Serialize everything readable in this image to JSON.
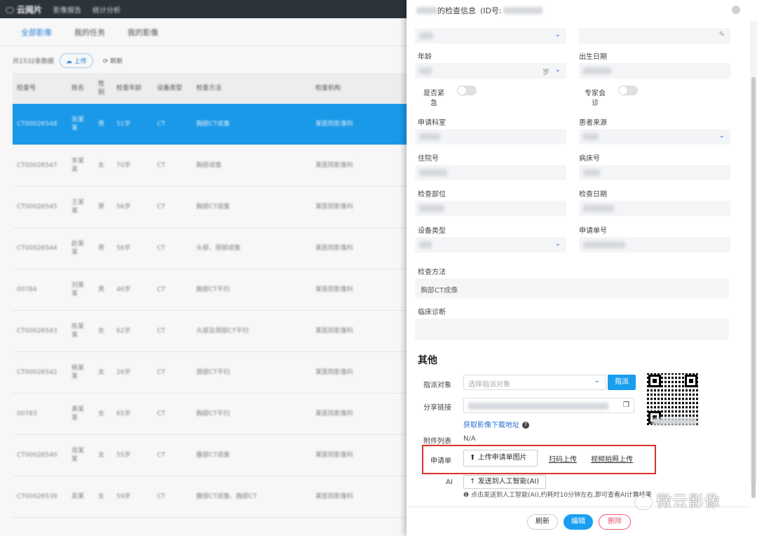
{
  "topbar": {
    "brand": "云阅片",
    "nav": [
      "影像报告",
      "统计分析"
    ]
  },
  "tabs": [
    "全部影像",
    "我的任务",
    "我的影像"
  ],
  "toolbar": {
    "count": "共1532条数据",
    "upload": "上传",
    "refresh": "刷新"
  },
  "table": {
    "columns": [
      "检查号",
      "姓名",
      "性别",
      "检查年龄",
      "设备类型",
      "检查方法",
      "检查机构"
    ],
    "rows": [
      [
        "CT00026548",
        "张某某",
        "男",
        "51岁",
        "CT",
        "胸部CT成像",
        "某医院影像科"
      ],
      [
        "CT00026547",
        "李某某",
        "女",
        "70岁",
        "CT",
        "胸部成像",
        "某医院影像科"
      ],
      [
        "CT00026545",
        "王某某",
        "男",
        "56岁",
        "CT",
        "胸部CT成像",
        "某医院影像科"
      ],
      [
        "CT00026544",
        "赵某某",
        "男",
        "56岁",
        "CT",
        "头部、颈部成像",
        "某医院影像科"
      ],
      [
        "00784",
        "刘某某",
        "男",
        "46岁",
        "CT",
        "胸部CT平扫",
        "某医院影像科"
      ],
      [
        "CT00026543",
        "陈某某",
        "女",
        "62岁",
        "CT",
        "头部及颈部CT平扫",
        "某医院影像科"
      ],
      [
        "CT00026542",
        "杨某某",
        "女",
        "26岁",
        "CT",
        "颈部CT平扫",
        "某医院影像科"
      ],
      [
        "00783",
        "黄某某",
        "女",
        "65岁",
        "CT",
        "胸部CT平扫",
        "某医院影像科"
      ],
      [
        "CT00026540",
        "周某某",
        "女",
        "55岁",
        "CT",
        "腹部CT成像",
        "某医院影像科"
      ],
      [
        "CT00026539",
        "吴某",
        "女",
        "59岁",
        "CT",
        "腹部CT成像、胸部CT",
        "某医院影像科"
      ]
    ]
  },
  "panel": {
    "title": "的检查信息",
    "id_label": "(ID号:",
    "labels": {
      "age": "年龄",
      "birth": "出生日期",
      "urgent": "是否紧急",
      "expert": "专家会诊",
      "dept": "申请科室",
      "source": "患者来源",
      "inpatient": "住院号",
      "bed": "病床号",
      "part": "检查部位",
      "date": "检查日期",
      "device": "设备类型",
      "order": "申请单号",
      "method": "检查方法",
      "diagnosis": "临床诊断"
    },
    "age_unit": "岁",
    "method_value": "胸部CT成像",
    "other": {
      "title": "其他",
      "assign_label": "指派对象",
      "assign_placeholder": "选择指派对象",
      "assign_button": "指派",
      "share_label": "分享链接",
      "download_link": "获取影像下载地址",
      "attach_label": "附件列表",
      "attach_value": "N/A",
      "request_label": "申请单",
      "upload_image": "上传申请单图片",
      "scan_upload": "扫码上传",
      "video_upload": "视频拍照上传",
      "ai_label": "AI",
      "ai_button": "发送到人工智能(AI)",
      "ai_note": "点击发送到人工智能(AI),约耗时10分钟左右,即可查看AI计算结果"
    },
    "footer": {
      "refresh": "刷新",
      "edit": "编辑",
      "delete": "删除"
    }
  },
  "watermark": "微云影像"
}
